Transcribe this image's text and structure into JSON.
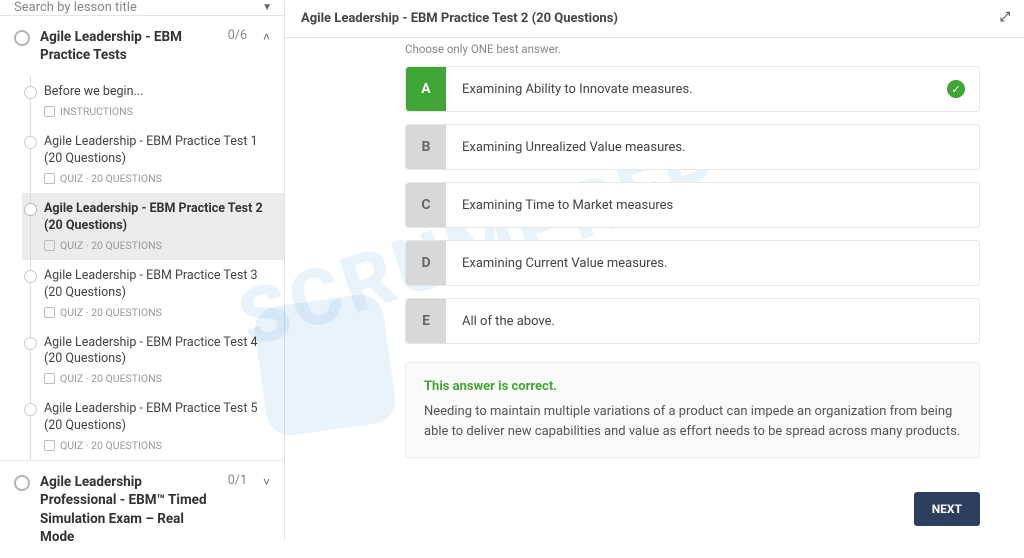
{
  "search": {
    "placeholder": "Search by lesson title"
  },
  "sections": [
    {
      "title": "Agile Leadership - EBM Practice Tests",
      "count": "0/6",
      "expanded": true,
      "items": [
        {
          "title": "Before we begin...",
          "meta": "INSTRUCTIONS",
          "active": false
        },
        {
          "title": "Agile Leadership - EBM Practice Test 1 (20 Questions)",
          "meta": "QUIZ · 20 QUESTIONS",
          "active": false
        },
        {
          "title": "Agile Leadership - EBM Practice Test 2 (20 Questions)",
          "meta": "QUIZ · 20 QUESTIONS",
          "active": true
        },
        {
          "title": "Agile Leadership - EBM Practice Test 3 (20 Questions)",
          "meta": "QUIZ · 20 QUESTIONS",
          "active": false
        },
        {
          "title": "Agile Leadership - EBM Practice Test 4 (20 Questions)",
          "meta": "QUIZ · 20 QUESTIONS",
          "active": false
        },
        {
          "title": "Agile Leadership - EBM Practice Test 5 (20 Questions)",
          "meta": "QUIZ · 20 QUESTIONS",
          "active": false
        }
      ]
    },
    {
      "title": "Agile Leadership Professional - EBM™ Timed Simulation Exam – Real Mode",
      "count": "0/1",
      "expanded": false
    }
  ],
  "header": {
    "title": "Agile Leadership - EBM Practice Test 2 (20 Questions)"
  },
  "question": {
    "instruction": "Choose only ONE best answer.",
    "choices": [
      {
        "letter": "A",
        "text": "Examining Ability to Innovate measures.",
        "correct": true
      },
      {
        "letter": "B",
        "text": "Examining Unrealized Value measures.",
        "correct": false
      },
      {
        "letter": "C",
        "text": "Examining Time to Market measures",
        "correct": false
      },
      {
        "letter": "D",
        "text": "Examining Current Value measures.",
        "correct": false
      },
      {
        "letter": "E",
        "text": "All of the above.",
        "correct": false
      }
    ],
    "feedback": {
      "title": "This answer is correct.",
      "text": "Needing to maintain multiple variations of a product can impede an organization from being able to deliver new capabilities and value as effort needs to be spread across many products."
    }
  },
  "buttons": {
    "next": "NEXT"
  },
  "watermark": "SCRUMPREP"
}
